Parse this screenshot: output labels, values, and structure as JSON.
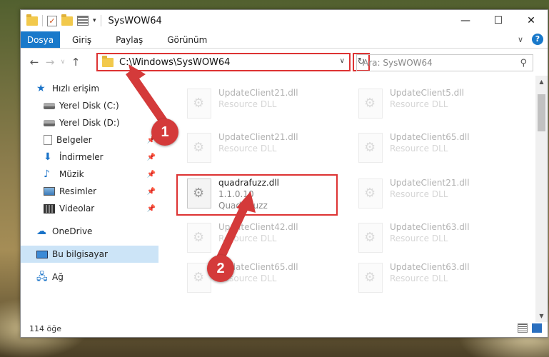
{
  "window": {
    "title": "SysWOW64",
    "controls": {
      "minimize": "—",
      "maximize": "☐",
      "close": "✕"
    }
  },
  "ribbon": {
    "tabs": [
      {
        "label": "Dosya",
        "active": true
      },
      {
        "label": "Giriş"
      },
      {
        "label": "Paylaş"
      },
      {
        "label": "Görünüm"
      }
    ],
    "help": "?"
  },
  "navigation": {
    "address": "C:\\Windows\\SysWOW64",
    "search_placeholder": "Ara: SysWOW64"
  },
  "sidebar": {
    "items": [
      {
        "label": "Hızlı erişim",
        "icon": "star-icon"
      },
      {
        "label": "Yerel Disk (C:)",
        "icon": "disk-icon"
      },
      {
        "label": "Yerel Disk (D:)",
        "icon": "disk-icon"
      },
      {
        "label": "Belgeler",
        "icon": "document-icon"
      },
      {
        "label": "İndirmeler",
        "icon": "download-icon"
      },
      {
        "label": "Müzik",
        "icon": "music-icon"
      },
      {
        "label": "Resimler",
        "icon": "pictures-icon"
      },
      {
        "label": "Videolar",
        "icon": "video-icon"
      },
      {
        "label": "OneDrive",
        "icon": "cloud-icon"
      },
      {
        "label": "Bu bilgisayar",
        "icon": "computer-icon",
        "selected": true
      },
      {
        "label": "Ağ",
        "icon": "network-icon"
      }
    ]
  },
  "files": [
    {
      "name": "UpdateClient21.dll",
      "desc": "Resource DLL"
    },
    {
      "name": "UpdateClient5.dll",
      "desc": "Resource DLL"
    },
    {
      "name": "UpdateClient21.dll",
      "desc": "Resource DLL"
    },
    {
      "name": "UpdateClient65.dll",
      "desc": "Resource DLL"
    },
    {
      "name": "quadrafuzz.dll",
      "version": "1.1.0.10",
      "desc": "Quadrafuzz",
      "highlighted": true
    },
    {
      "name": "UpdateClient21.dll",
      "desc": "Resource DLL"
    },
    {
      "name": "UpdateClient42.dll",
      "desc": "Resource DLL"
    },
    {
      "name": "UpdateClient63.dll",
      "desc": "Resource DLL"
    },
    {
      "name": "UpdateClient65.dll",
      "desc": "Resource DLL"
    },
    {
      "name": "UpdateClient63.dll",
      "desc": "Resource DLL"
    }
  ],
  "status": {
    "count": "114 öğe"
  },
  "annotations": {
    "step1": "1",
    "step2": "2",
    "color": "#d43a3a"
  }
}
